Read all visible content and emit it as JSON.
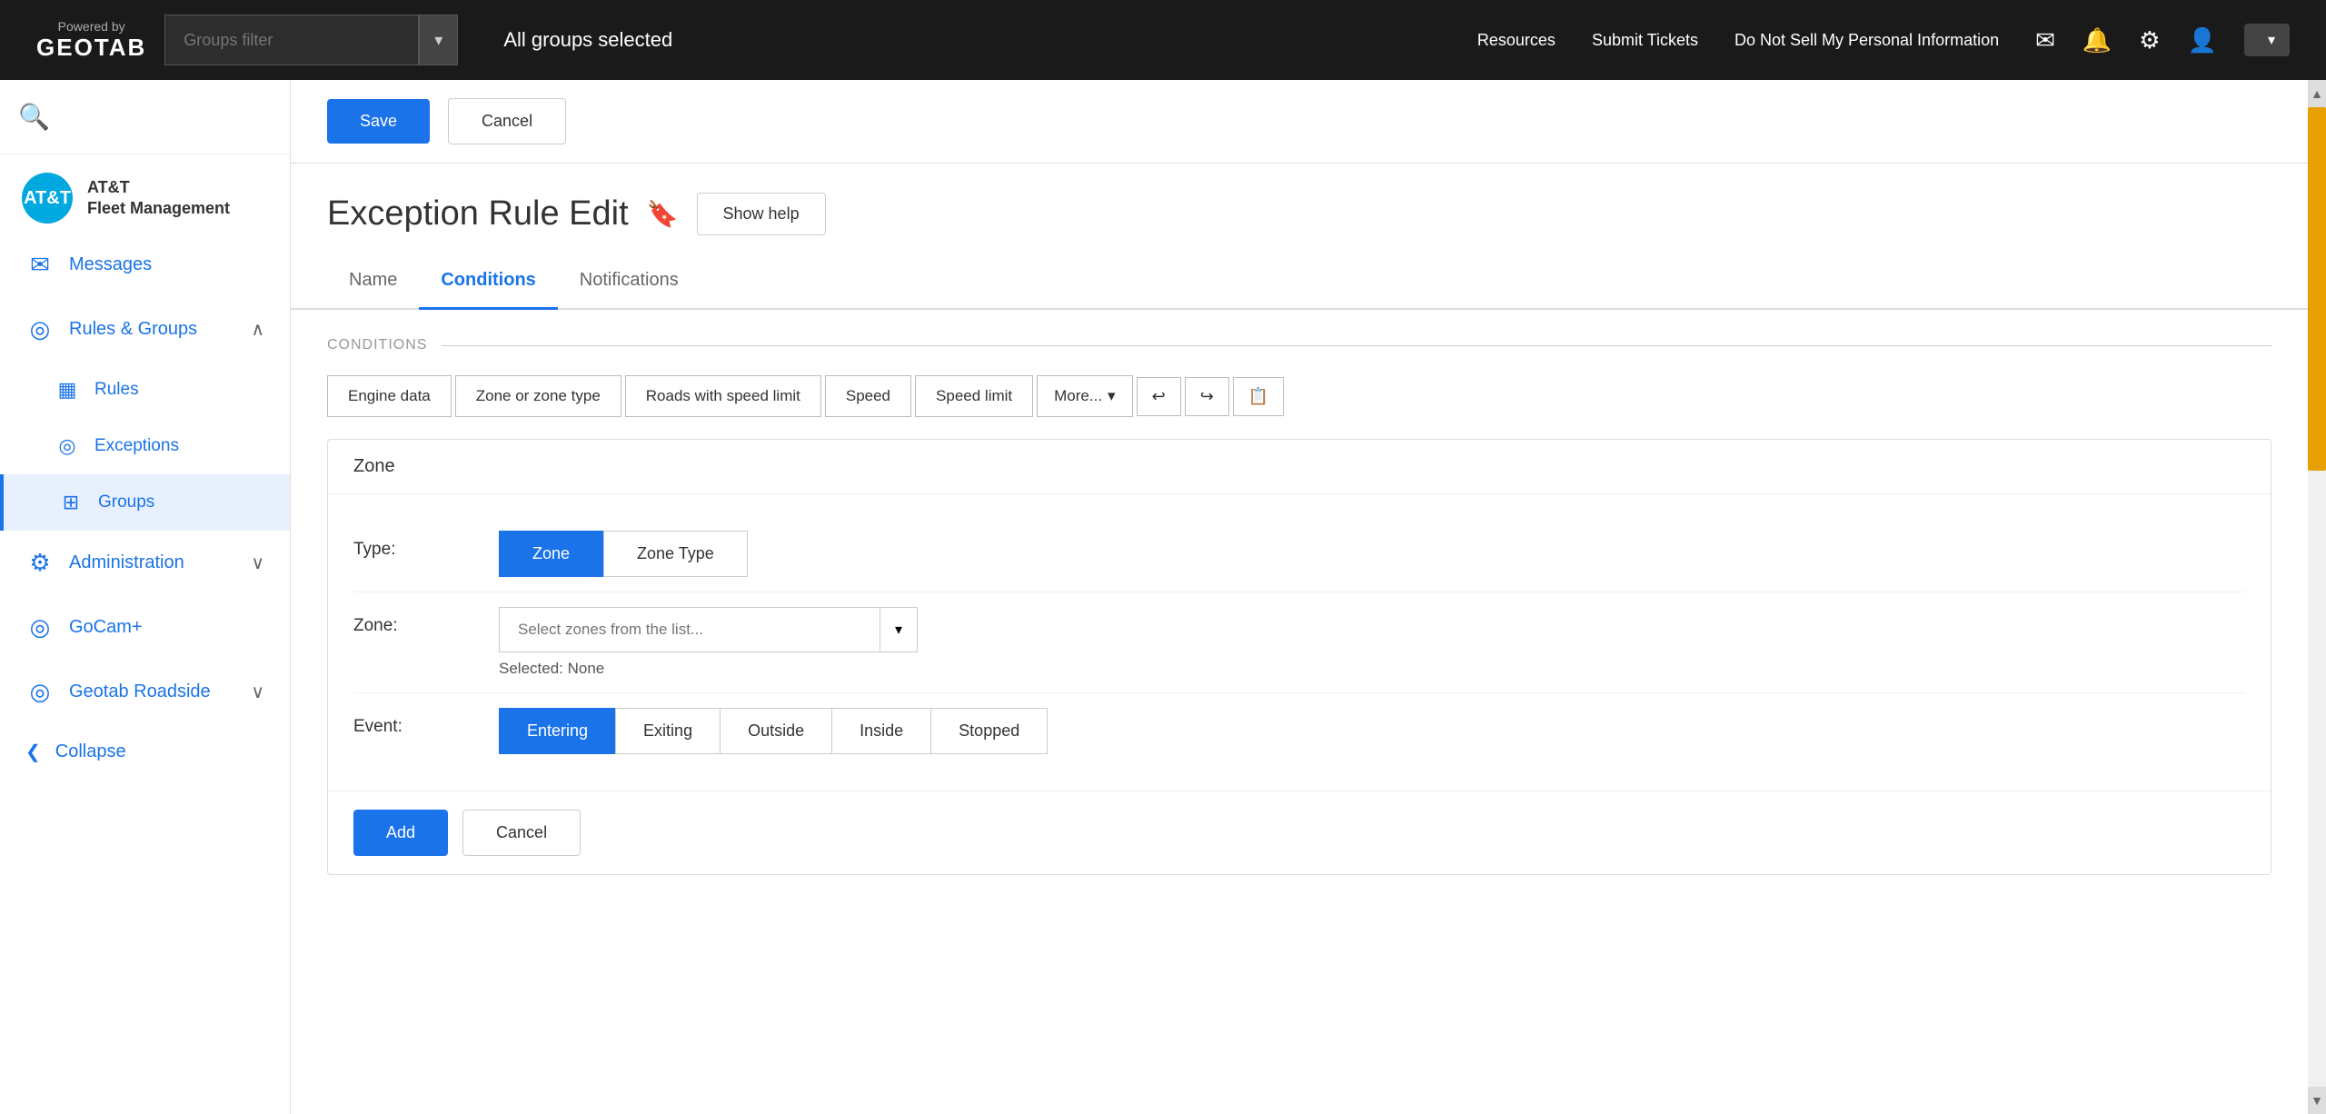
{
  "topbar": {
    "powered_by": "Powered by",
    "brand": "GEOTAB",
    "links": [
      {
        "label": "Resources",
        "id": "resources"
      },
      {
        "label": "Submit Tickets",
        "id": "submit-tickets"
      },
      {
        "label": "Do Not Sell My Personal Information",
        "id": "do-not-sell"
      }
    ],
    "groups_filter_label": "Groups filter",
    "groups_selected": "All groups selected"
  },
  "sidebar": {
    "logo_abbr": "AT&T",
    "logo_line1": "AT&T",
    "logo_line2": "Fleet Management",
    "search_placeholder": "Search",
    "items": [
      {
        "id": "messages",
        "label": "Messages",
        "icon": "✉",
        "expandable": false
      },
      {
        "id": "rules-groups",
        "label": "Rules & Groups",
        "icon": "◎",
        "expandable": true,
        "expanded": true
      },
      {
        "id": "rules",
        "label": "Rules",
        "icon": "▦",
        "sub": true
      },
      {
        "id": "exceptions",
        "label": "Exceptions",
        "icon": "◎",
        "sub": true
      },
      {
        "id": "groups",
        "label": "Groups",
        "icon": "⊞",
        "sub": true,
        "active": true
      },
      {
        "id": "administration",
        "label": "Administration",
        "icon": "⚙",
        "expandable": true
      },
      {
        "id": "gocam",
        "label": "GoCam+",
        "icon": "◎",
        "expandable": false
      },
      {
        "id": "geotab-roadside",
        "label": "Geotab Roadside",
        "icon": "◎",
        "expandable": true
      }
    ],
    "collapse_label": "Collapse",
    "collapse_icon": "❮"
  },
  "header": {
    "save_label": "Save",
    "cancel_label": "Cancel"
  },
  "page": {
    "title": "Exception Rule Edit",
    "show_help_label": "Show help",
    "tabs": [
      {
        "id": "name",
        "label": "Name"
      },
      {
        "id": "conditions",
        "label": "Conditions",
        "active": true
      },
      {
        "id": "notifications",
        "label": "Notifications"
      }
    ]
  },
  "conditions": {
    "section_label": "CONDITIONS",
    "toolbar_buttons": [
      {
        "id": "engine-data",
        "label": "Engine data"
      },
      {
        "id": "zone-or-zone-type",
        "label": "Zone or zone type"
      },
      {
        "id": "roads-with-speed-limit",
        "label": "Roads with speed limit"
      },
      {
        "id": "speed",
        "label": "Speed"
      },
      {
        "id": "speed-limit",
        "label": "Speed limit"
      },
      {
        "id": "more",
        "label": "More..."
      }
    ],
    "zone_card": {
      "title": "Zone",
      "type_label": "Type:",
      "type_buttons": [
        {
          "id": "zone",
          "label": "Zone",
          "active": true
        },
        {
          "id": "zone-type",
          "label": "Zone Type",
          "active": false
        }
      ],
      "zone_label": "Zone:",
      "zone_placeholder": "Select zones from the list...",
      "zone_selected": "Selected: None",
      "event_label": "Event:",
      "event_buttons": [
        {
          "id": "entering",
          "label": "Entering",
          "active": true
        },
        {
          "id": "exiting",
          "label": "Exiting",
          "active": false
        },
        {
          "id": "outside",
          "label": "Outside",
          "active": false
        },
        {
          "id": "inside",
          "label": "Inside",
          "active": false
        },
        {
          "id": "stopped",
          "label": "Stopped",
          "active": false
        }
      ],
      "add_label": "Add",
      "cancel_label": "Cancel"
    }
  }
}
